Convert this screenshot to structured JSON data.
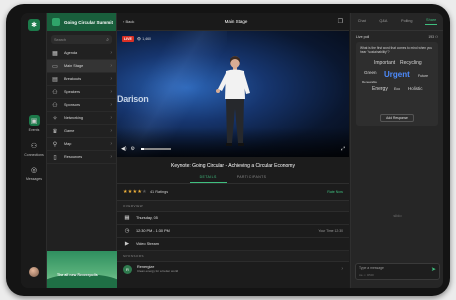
{
  "event": {
    "title": "Going Circular Summit",
    "search_placeholder": "Search",
    "nav": [
      {
        "label": "Agenda",
        "icon": "calendar-icon"
      },
      {
        "label": "Main Stage",
        "icon": "tv-icon",
        "active": true
      },
      {
        "label": "Breakouts",
        "icon": "grid-icon"
      },
      {
        "label": "Speakers",
        "icon": "people-icon"
      },
      {
        "label": "Sponsors",
        "icon": "people-icon"
      },
      {
        "label": "Networking",
        "icon": "handshake-icon"
      },
      {
        "label": "Game",
        "icon": "trophy-icon"
      },
      {
        "label": "Map",
        "icon": "map-icon"
      },
      {
        "label": "Resources",
        "icon": "document-icon"
      }
    ],
    "promo_text": "The all new Reverepolis"
  },
  "rail": {
    "items": [
      {
        "label": "Events",
        "icon": "events-icon",
        "active": true
      },
      {
        "label": "Connections",
        "icon": "connections-icon"
      },
      {
        "label": "Messages",
        "icon": "messages-icon"
      }
    ]
  },
  "stage": {
    "back_label": "‹ Back",
    "header_title": "Main Stage",
    "live_tag": "LIVE",
    "viewers": "1,460",
    "brand_text": "Darison",
    "session_title": "Keynote: Going Circular - Achieving a Circular Economy",
    "tabs": [
      {
        "label": "DETAILS",
        "active": true
      },
      {
        "label": "PARTICIPANTS",
        "active": false
      }
    ],
    "rating": {
      "stars": 4.5,
      "count_text": "41 Ratings",
      "rate_label": "Rate Now"
    },
    "overview_label": "OVERVIEW",
    "date": "Thursday, 05",
    "time": "12:30 PM - 1:30 PM",
    "time_aux": "Your Time 12:30",
    "stream": "Video Stream",
    "sponsors_label": "SPONSORS",
    "sponsor": {
      "name": "Renergize",
      "desc": "Clean energy for a better world"
    }
  },
  "side_panel": {
    "tabs": [
      {
        "label": "Chat",
        "active": false
      },
      {
        "label": "Q&A",
        "active": false
      },
      {
        "label": "Polling",
        "active": false
      },
      {
        "label": "Share",
        "active": true
      }
    ],
    "poll_label": "Live poll",
    "poll_count": "193",
    "question": "What is the first word that comes to mind when you hear \"sustainability\"?",
    "words": [
      {
        "text": "Important",
        "size": 5
      },
      {
        "text": "Recycling",
        "size": 5
      },
      {
        "text": "Green",
        "size": 4.5
      },
      {
        "text": "Urgent",
        "size": 8,
        "color": "#4d8cff"
      },
      {
        "text": "Renewable",
        "size": 3
      },
      {
        "text": "Future",
        "size": 3.5
      },
      {
        "text": "Energy",
        "size": 5
      },
      {
        "text": "Eco",
        "size": 3.5
      },
      {
        "text": "Holistic",
        "size": 4.5
      }
    ],
    "add_label": "Add Response",
    "brand_logo": "slido",
    "message_placeholder": "Type a message",
    "message_meta": "Aa  ☺  0/500"
  },
  "colors": {
    "accent": "#3fbf7f",
    "live": "#d93025",
    "brand_green": "#195f3c"
  }
}
